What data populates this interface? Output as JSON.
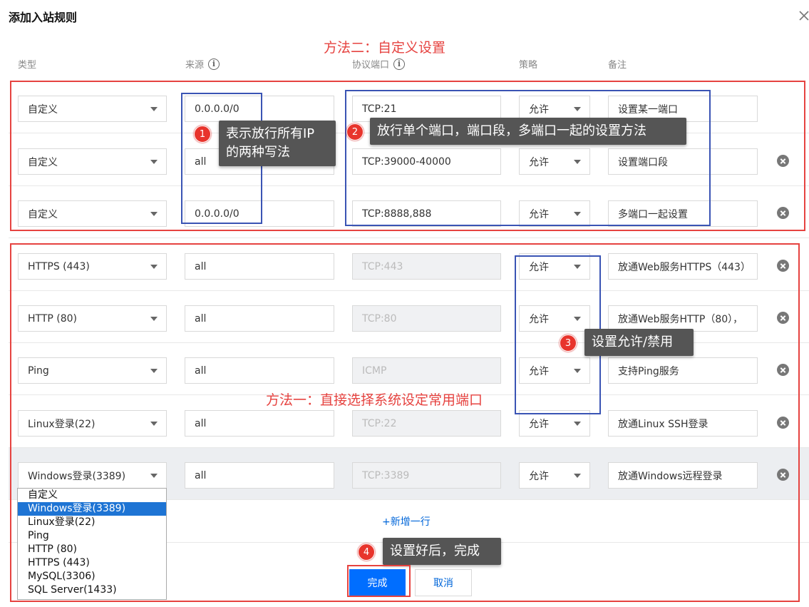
{
  "dialog": {
    "title": "添加入站规则"
  },
  "headers": {
    "type": "类型",
    "source": "来源",
    "port": "协议端口",
    "policy": "策略",
    "note": "备注",
    "info": "i"
  },
  "rows": [
    {
      "type": "自定义",
      "source": "0.0.0.0/0",
      "port": "TCP:21",
      "policy": "允许",
      "note": "设置某一端口",
      "port_disabled": false,
      "removable": false
    },
    {
      "type": "自定义",
      "source": "all",
      "port": "TCP:39000-40000",
      "policy": "允许",
      "note": "设置端口段",
      "port_disabled": false,
      "removable": true
    },
    {
      "type": "自定义",
      "source": "0.0.0.0/0",
      "port": "TCP:8888,888",
      "policy": "允许",
      "note": "多端口一起设置",
      "port_disabled": false,
      "removable": true
    },
    {
      "type": "HTTPS (443)",
      "source": "all",
      "port": "TCP:443",
      "policy": "允许",
      "note": "放通Web服务HTTPS（443）",
      "port_disabled": true,
      "removable": true
    },
    {
      "type": "HTTP (80)",
      "source": "all",
      "port": "TCP:80",
      "policy": "允许",
      "note": "放通Web服务HTTP（80），",
      "port_disabled": true,
      "removable": true
    },
    {
      "type": "Ping",
      "source": "all",
      "port": "ICMP",
      "policy": "允许",
      "note": "支持Ping服务",
      "port_disabled": true,
      "removable": true
    },
    {
      "type": "Linux登录(22)",
      "source": "all",
      "port": "TCP:22",
      "policy": "允许",
      "note": "放通Linux SSH登录",
      "port_disabled": true,
      "removable": true
    },
    {
      "type": "Windows登录(3389)",
      "source": "all",
      "port": "TCP:3389",
      "policy": "允许",
      "note": "放通Windows远程登录",
      "port_disabled": true,
      "removable": true
    }
  ],
  "dropdown": {
    "options": [
      "自定义",
      "Windows登录(3389)",
      "Linux登录(22)",
      "Ping",
      "HTTP (80)",
      "HTTPS (443)",
      "MySQL(3306)",
      "SQL Server(1433)"
    ],
    "selected": "Windows登录(3389)"
  },
  "add_row_label": "+新增一行",
  "buttons": {
    "ok": "完成",
    "cancel": "取消"
  },
  "annotations": {
    "method2": "方法二：自定义设置",
    "method1": "方法一：直接选择系统设定常用端口",
    "tip1_line1": "表示放行所有IP",
    "tip1_line2": "的两种写法",
    "tip2": "放行单个端口，端口段，多端口一起的设置方法",
    "tip3": "设置允许/禁用",
    "tip4": "设置好后，完成",
    "badge1": "1",
    "badge2": "2",
    "badge3": "3",
    "badge4": "4"
  },
  "colors": {
    "annotation_red": "#e64340",
    "annotation_blue": "#3a54b4",
    "primary": "#006eff",
    "link": "#0066d9"
  }
}
